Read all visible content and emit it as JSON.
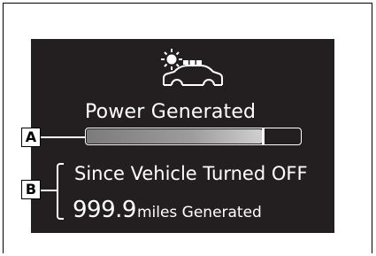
{
  "display": {
    "title": "Power Generated",
    "power_bar": {
      "level_percent": 82
    },
    "since_label": "Since Vehicle Turned OFF",
    "value": "999.9",
    "unit_label": "miles Generated"
  },
  "callouts": {
    "a": "A",
    "b": "B"
  },
  "icons": [
    "sun-icon",
    "solar-car-icon"
  ],
  "colors": {
    "screen_bg": "#231f20",
    "text": "#ffffff",
    "bar_fill": "#9d9d9d"
  }
}
